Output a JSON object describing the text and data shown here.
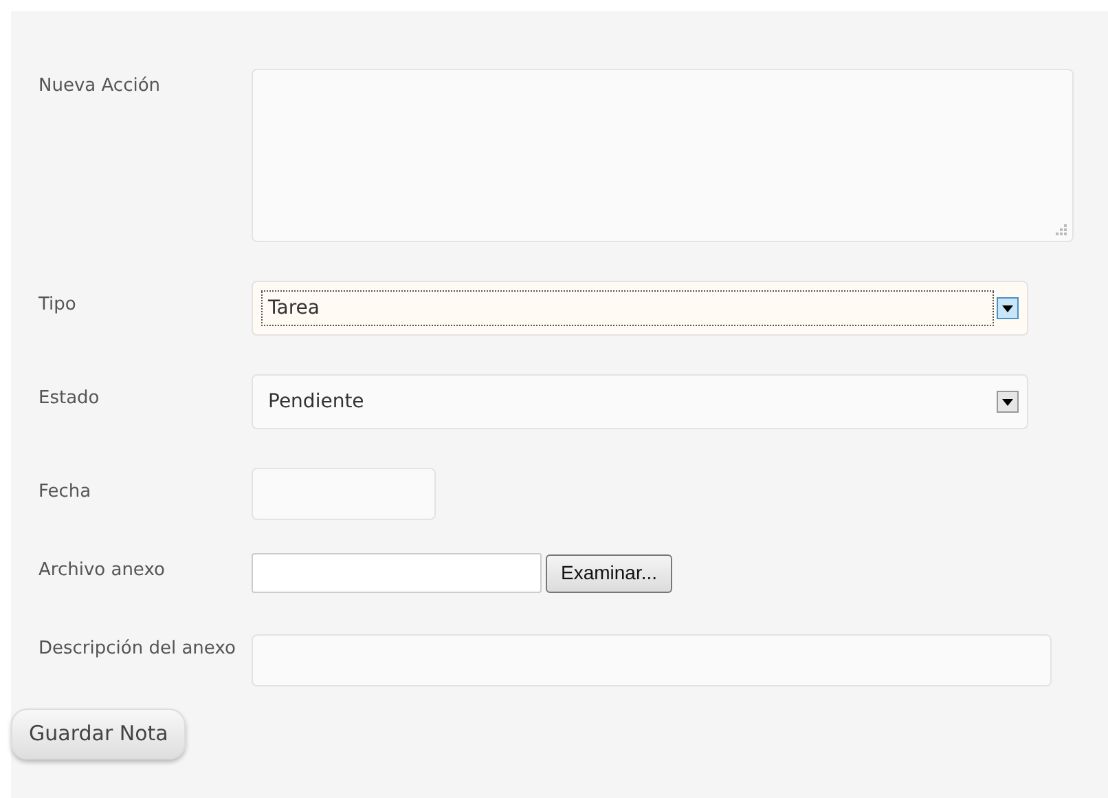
{
  "form": {
    "fields": [
      {
        "kind": "textarea",
        "label": "Nueva Acción"
      },
      {
        "kind": "select",
        "label": "Tipo",
        "value": "Tarea",
        "focused": true
      },
      {
        "kind": "select",
        "label": "Estado",
        "value": "Pendiente",
        "focused": false
      },
      {
        "kind": "date",
        "label": "Fecha"
      },
      {
        "kind": "file",
        "label": "Archivo anexo",
        "button": "Examinar..."
      },
      {
        "kind": "text",
        "label": "Descripción del anexo"
      }
    ],
    "submit": "Guardar Nota"
  }
}
